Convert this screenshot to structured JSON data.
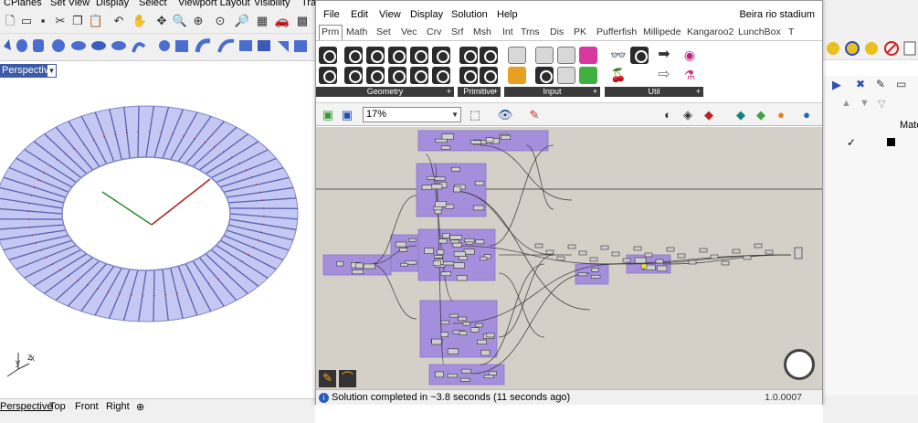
{
  "rhino": {
    "menu": [
      "CPlanes",
      "Set View",
      "Display",
      "Select",
      "Viewport Layout",
      "Visibility",
      "Tra"
    ],
    "viewport_title": "Perspective",
    "viewport_tabs": [
      "Perspective",
      "Top",
      "Front",
      "Right"
    ],
    "add_tab": "⊕",
    "axis": {
      "x": "x",
      "y": "y",
      "z": "z"
    }
  },
  "gh": {
    "menu": [
      "File",
      "Edit",
      "View",
      "Display",
      "Solution",
      "Help"
    ],
    "document_title": "Beira rio stadium",
    "tabs": [
      "Prm",
      "Math",
      "Set",
      "Vec",
      "Crv",
      "Srf",
      "Msh",
      "Int",
      "Trns",
      "Dis",
      "PK",
      "Pufferfish",
      "Millipede",
      "Kangaroo2",
      "LunchBox",
      "T"
    ],
    "active_tab": "Prm",
    "ribbon_groups": [
      "Geometry",
      "Primitive",
      "Input",
      "Util"
    ],
    "zoom": "17%",
    "status": "Solution completed in ~3.8 seconds (11 seconds ago)",
    "version": "1.0.0007"
  },
  "right_panel": {
    "header": "Mate",
    "row_mark": "✓"
  },
  "colors": {
    "group_fill": "#a58fdc",
    "canvas_bg": "#d4d0c8",
    "torus": "#c4c8f2",
    "rhino_accent": "#3b5ba8"
  }
}
